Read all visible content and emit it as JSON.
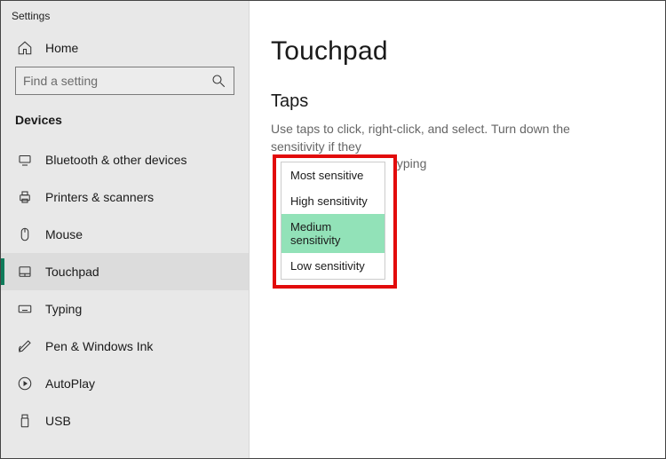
{
  "window_title": "Settings",
  "home_label": "Home",
  "search": {
    "placeholder": "Find a setting"
  },
  "category_header": "Devices",
  "nav": [
    {
      "label": "Bluetooth & other devices"
    },
    {
      "label": "Printers & scanners"
    },
    {
      "label": "Mouse"
    },
    {
      "label": "Touchpad"
    },
    {
      "label": "Typing"
    },
    {
      "label": "Pen & Windows Ink"
    },
    {
      "label": "AutoPlay"
    },
    {
      "label": "USB"
    }
  ],
  "main": {
    "title": "Touchpad",
    "section": "Taps",
    "description_visible_pre": "Use taps to click, right-click, and select. Turn down the sensitivity if they",
    "description_visible_trail": "yping"
  },
  "dropdown": {
    "options": [
      "Most sensitive",
      "High sensitivity",
      "Medium sensitivity",
      "Low sensitivity"
    ],
    "selected_index": 2
  }
}
